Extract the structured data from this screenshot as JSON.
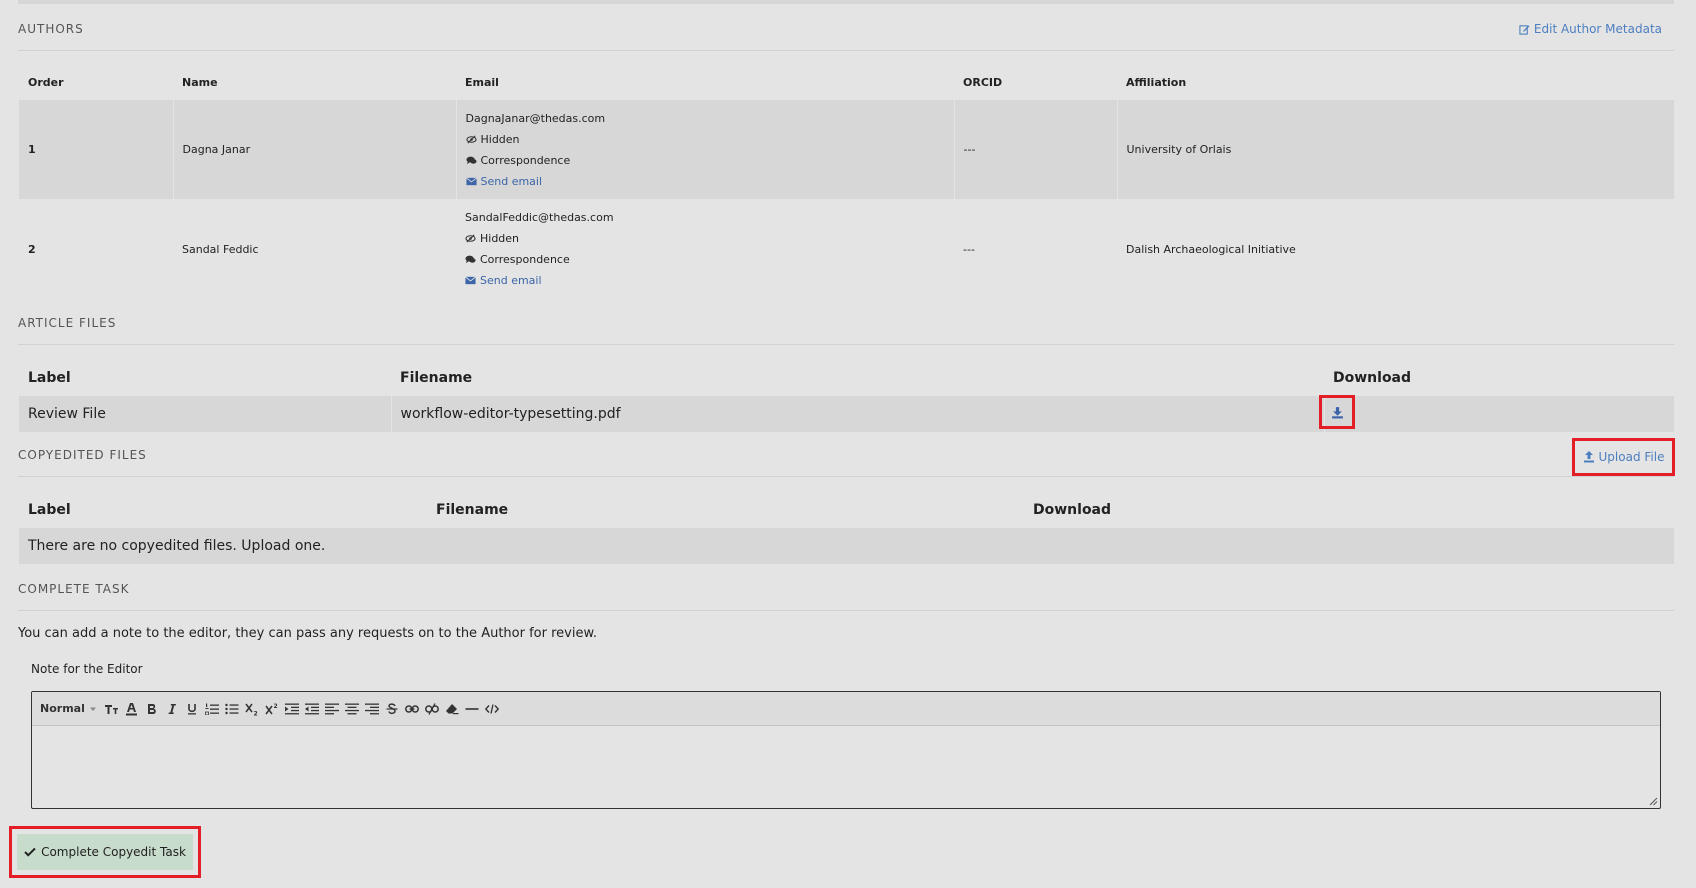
{
  "authors": {
    "title": "AUTHORS",
    "edit_link": "Edit Author Metadata",
    "columns": [
      "Order",
      "Name",
      "Email",
      "ORCID",
      "Affiliation"
    ],
    "rows": [
      {
        "order": "1",
        "name": "Dagna Janar",
        "email": "DagnaJanar@thedas.com",
        "hidden": "Hidden",
        "correspondence": "Correspondence",
        "send_email": "Send email",
        "orcid": "---",
        "affiliation": "University of Orlais"
      },
      {
        "order": "2",
        "name": "Sandal Feddic",
        "email": "SandalFeddic@thedas.com",
        "hidden": "Hidden",
        "correspondence": "Correspondence",
        "send_email": "Send email",
        "orcid": "---",
        "affiliation": "Dalish Archaeological Initiative"
      }
    ]
  },
  "article_files": {
    "title": "ARTICLE FILES",
    "columns": [
      "Label",
      "Filename",
      "Download"
    ],
    "rows": [
      {
        "label": "Review File",
        "filename": "workflow-editor-typesetting.pdf"
      }
    ]
  },
  "copyedited_files": {
    "title": "COPYEDITED FILES",
    "upload_label": "Upload File",
    "columns": [
      "Label",
      "Filename",
      "Download"
    ],
    "empty_message": "There are no copyedited files. Upload one."
  },
  "complete_task": {
    "title": "COMPLETE TASK",
    "description": "You can add a note to the editor, they can pass any requests on to the Author for review.",
    "note_label": "Note for the Editor",
    "format_select": "Normal",
    "button_label": "Complete Copyedit Task"
  },
  "colors": {
    "accent_link": "#4d7fc0",
    "highlight": "#e41e26",
    "button_bg": "#c8dccb"
  }
}
